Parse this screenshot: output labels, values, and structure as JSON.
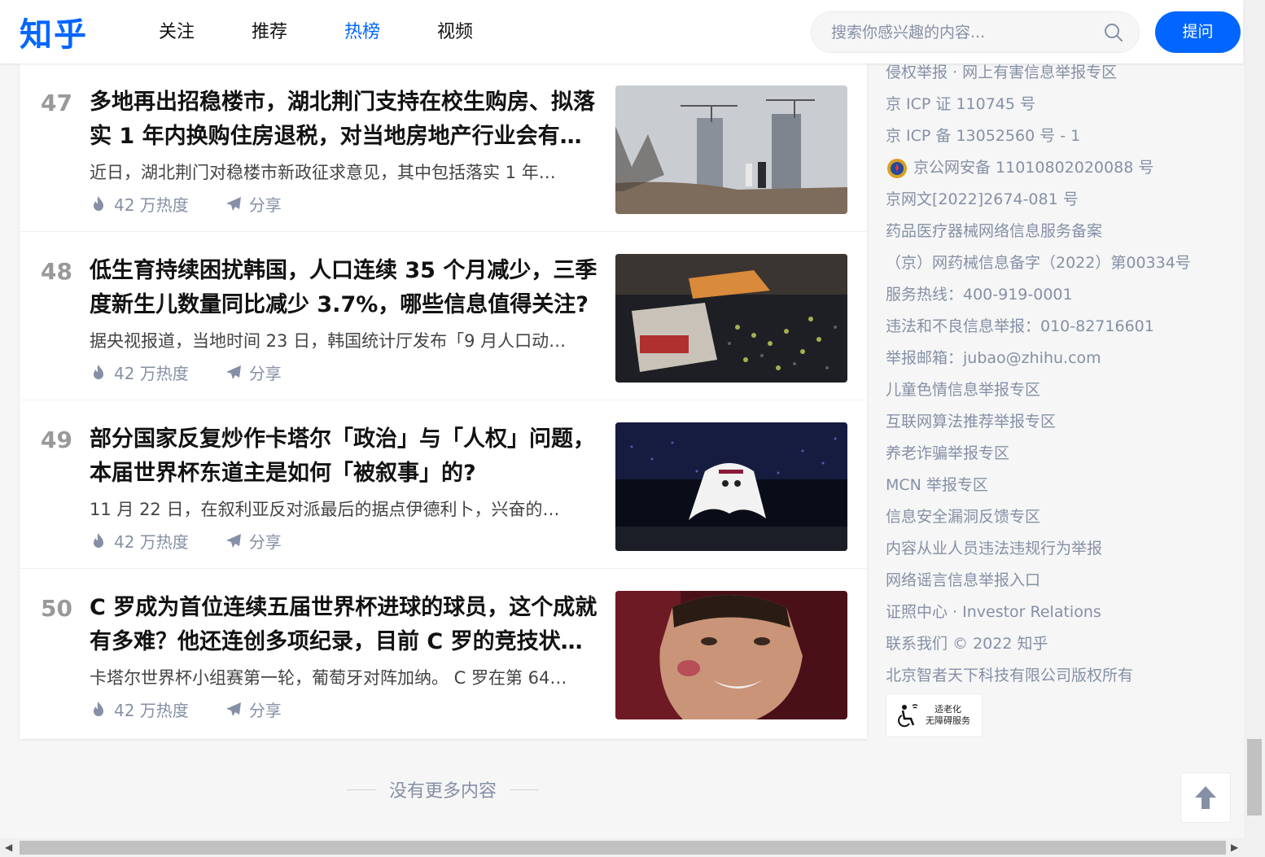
{
  "header": {
    "logo": "知乎",
    "tabs": [
      {
        "label": "关注"
      },
      {
        "label": "推荐"
      },
      {
        "label": "热榜"
      },
      {
        "label": "视频"
      }
    ],
    "active_tab": "热榜",
    "search_placeholder": "搜索你感兴趣的内容...",
    "ask_label": "提问"
  },
  "items": [
    {
      "rank": "47",
      "title": "多地再出招稳楼市，湖北荆门支持在校生购房、拟落实 1 年内换购住房退税，对当地房地产行业会有…",
      "excerpt": "近日，湖北荆门对稳楼市新政征求意见，其中包括落实 1 年…",
      "heat": "42 万热度",
      "share": "分享"
    },
    {
      "rank": "48",
      "title": "低生育持续困扰韩国，人口连续 35 个月减少，三季度新生儿数量同比减少 3.7%，哪些信息值得关注?",
      "excerpt": "据央视报道，当地时间 23 日，韩国统计厅发布「9 月人口动…",
      "heat": "42 万热度",
      "share": "分享"
    },
    {
      "rank": "49",
      "title": "部分国家反复炒作卡塔尔「政治」与「人权」问题，本届世界杯东道主是如何「被叙事」的?",
      "excerpt": "11 月 22 日，在叙利亚反对派最后的据点伊德利卜，兴奋的…",
      "heat": "42 万热度",
      "share": "分享"
    },
    {
      "rank": "50",
      "title": "C 罗成为首位连续五届世界杯进球的球员，这个成就有多难？他还连创多项纪录，目前 C 罗的竞技状…",
      "excerpt": "卡塔尔世界杯小组赛第一轮，葡萄牙对阵加纳。 C 罗在第 64…",
      "heat": "42 万热度",
      "share": "分享"
    }
  ],
  "no_more": "没有更多内容",
  "footer": {
    "links": [
      "侵权举报 · 网上有害信息举报专区",
      "京 ICP 证 110745 号",
      "京 ICP 备 13052560 号 - 1"
    ],
    "police": "京公网安备 11010802020088 号",
    "links2": [
      "京网文[2022]2674-081 号",
      "药品医疗器械网络信息服务备案",
      "（京）网药械信息备字（2022）第00334号",
      "服务热线：400-919-0001",
      "违法和不良信息举报：010-82716601",
      "举报邮箱：jubao@zhihu.com",
      "儿童色情信息举报专区",
      "互联网算法推荐举报专区",
      "养老诈骗举报专区",
      "MCN 举报专区",
      "信息安全漏洞反馈专区",
      "内容从业人员违法违规行为举报",
      "网络谣言信息举报入口",
      "证照中心 · Investor Relations",
      "联系我们 © 2022 知乎",
      "北京智者天下科技有限公司版权所有"
    ],
    "access_line1": "适老化",
    "access_line2": "无障碍服务"
  },
  "colors": {
    "brand": "#0066ff",
    "muted": "#8590a6",
    "rank": "#999999"
  },
  "icons": [
    "search-icon",
    "flame-icon",
    "paper-plane-icon",
    "police-badge-icon",
    "accessibility-icon",
    "arrow-up-icon"
  ]
}
